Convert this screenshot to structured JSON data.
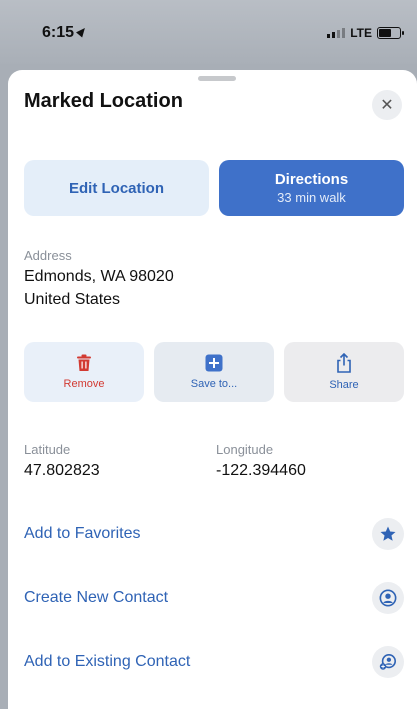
{
  "status": {
    "time": "6:15",
    "network": "LTE",
    "battery_level": 0.6
  },
  "sheet": {
    "title": "Marked Location",
    "close_glyph": "✕"
  },
  "actions": {
    "edit_label": "Edit Location",
    "directions_label": "Directions",
    "directions_sub": "33 min walk"
  },
  "address": {
    "label": "Address",
    "line1": "Edmonds, WA  98020",
    "line2": "United States"
  },
  "tools": [
    {
      "label": "Remove",
      "icon": "trash-icon"
    },
    {
      "label": "Save to...",
      "icon": "plus-square-icon"
    },
    {
      "label": "Share",
      "icon": "share-icon"
    }
  ],
  "coordinates": {
    "latitude_label": "Latitude",
    "latitude": "47.802823",
    "longitude_label": "Longitude",
    "longitude": "-122.394460"
  },
  "list": [
    {
      "label": "Add to Favorites",
      "icon": "star-icon"
    },
    {
      "label": "Create New Contact",
      "icon": "person-circle-icon"
    },
    {
      "label": "Add to Existing Contact",
      "icon": "person-add-icon"
    }
  ],
  "colors": {
    "accent": "#2f63b5",
    "primary_button": "#3f71c9",
    "destructive": "#d23a32",
    "secondary_text": "#8a9099"
  }
}
